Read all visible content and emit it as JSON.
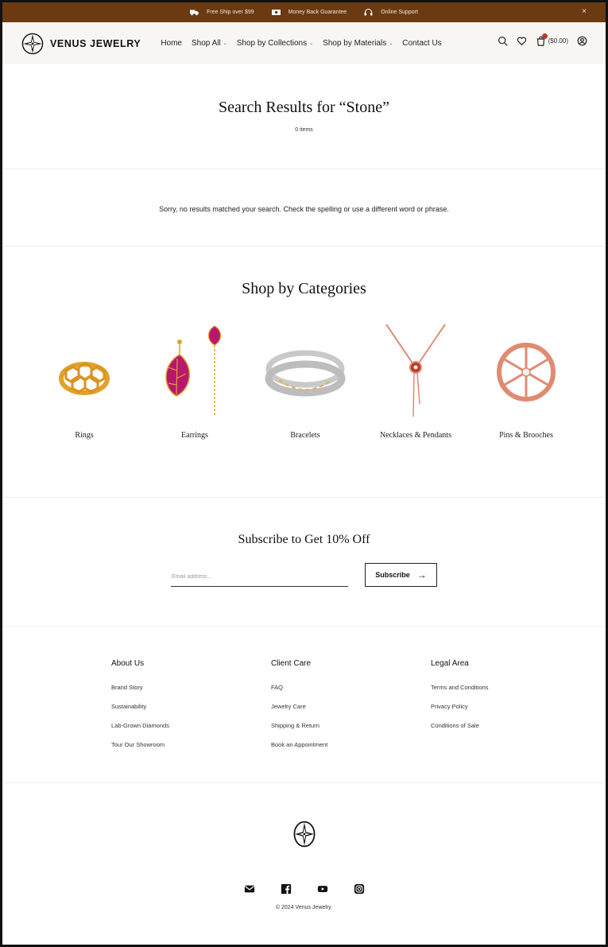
{
  "announcement": {
    "items": [
      {
        "icon": "truck-icon",
        "text": "Free Ship over $99"
      },
      {
        "icon": "money-icon",
        "text": "Money Back Guarantee"
      },
      {
        "icon": "headphones-icon",
        "text": "Online Support"
      }
    ],
    "close": "×"
  },
  "header": {
    "brand": "VENUS JEWELRY",
    "nav": [
      {
        "label": "Home",
        "dropdown": false
      },
      {
        "label": "Shop All",
        "dropdown": true
      },
      {
        "label": "Shop by Collections",
        "dropdown": true
      },
      {
        "label": "Shop by Materials",
        "dropdown": true
      },
      {
        "label": "Contact Us",
        "dropdown": false
      }
    ],
    "cart_total": "($0.00)"
  },
  "search": {
    "title": "Search Results for “Stone”",
    "count": "0 items",
    "no_results": "Sorry, no results matched your search. Check the spelling or use a different word or phrase."
  },
  "categories": {
    "title": "Shop by Categories",
    "items": [
      {
        "label": "Rings"
      },
      {
        "label": "Earrings"
      },
      {
        "label": "Bracelets"
      },
      {
        "label": "Necklaces & Pendants"
      },
      {
        "label": "Pins & Brooches"
      }
    ]
  },
  "subscribe": {
    "title": "Subscribe to Get 10% Off",
    "placeholder": "Email address...",
    "button": "Subscribe",
    "arrow": "→"
  },
  "footer": {
    "columns": [
      {
        "head": "About Us",
        "links": [
          "Brand Story",
          "Sustainability",
          "Lab-Grown Diamonds",
          "Tour Our Showroom"
        ]
      },
      {
        "head": "Client Care",
        "links": [
          "FAQ",
          "Jewelry Care",
          "Shipping & Return",
          "Book an Appointment"
        ]
      },
      {
        "head": "Legal Area",
        "links": [
          "Terms and Conditions",
          "Privacy Policy",
          "Conditions of Sale"
        ]
      }
    ],
    "copyright": "© 2024 Venus Jewelry."
  },
  "colors": {
    "topbar": "#6b3a13",
    "header_bg": "#f8f6f3",
    "gold": "#e0a22a",
    "magenta": "#b8176f",
    "rose_gold": "#e08a72",
    "badge": "#c0392b"
  }
}
